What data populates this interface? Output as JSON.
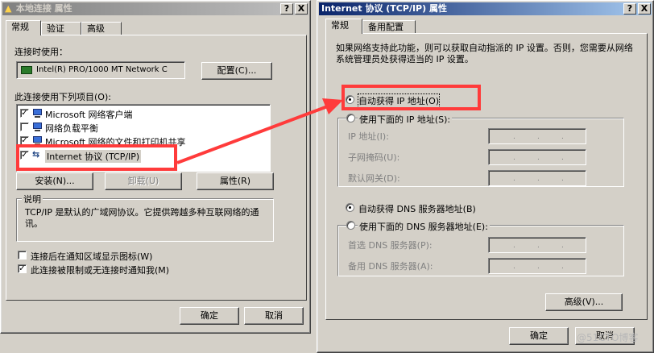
{
  "left_dialog": {
    "title": "本地连接 属性",
    "help_btn": "?",
    "close_btn": "X",
    "tabs": [
      "常规",
      "验证",
      "高级"
    ],
    "connect_using_label": "连接时使用：",
    "adapter_name": "Intel(R) PRO/1000 MT Network C",
    "configure_btn": "配置(C)...",
    "items_label": "此连接使用下列项目(O):",
    "items": [
      {
        "checked": true,
        "label": "Microsoft 网络客户端"
      },
      {
        "checked": false,
        "label": "网络负载平衡"
      },
      {
        "checked": true,
        "label": "Microsoft 网络的文件和打印机共享"
      },
      {
        "checked": true,
        "label": "Internet 协议 (TCP/IP)"
      }
    ],
    "install_btn": "安装(N)...",
    "uninstall_btn": "卸载(U)",
    "properties_btn": "属性(R)",
    "description_label": "说明",
    "description_text": "TCP/IP 是默认的广域网协议。它提供跨越多种互联网络的通讯。",
    "show_icon_label": "连接后在通知区域显示图标(W)",
    "notify_label": "此连接被限制或无连接时通知我(M)",
    "ok_btn": "确定",
    "cancel_btn": "取消"
  },
  "right_dialog": {
    "title": "Internet 协议 (TCP/IP) 属性",
    "help_btn": "?",
    "close_btn": "X",
    "tabs": [
      "常规",
      "备用配置"
    ],
    "intro_text": "如果网络支持此功能，则可以获取自动指派的 IP 设置。否则，您需要从网络系统管理员处获得适当的 IP 设置。",
    "auto_ip_label": "自动获得 IP 地址(O)",
    "manual_ip_label": "使用下面的 IP 地址(S):",
    "ip_address_label": "IP 地址(I):",
    "subnet_label": "子网掩码(U):",
    "gateway_label": "默认网关(D):",
    "auto_dns_label": "自动获得 DNS 服务器地址(B)",
    "manual_dns_label": "使用下面的 DNS 服务器地址(E):",
    "preferred_dns_label": "首选 DNS 服务器(P):",
    "alternate_dns_label": "备用 DNS 服务器(A):",
    "advanced_btn": "高级(V)...",
    "ok_btn": "确定",
    "cancel_btn": "取消",
    "auto_ip_selected": true,
    "auto_dns_selected": true
  },
  "watermark": "@51CTO博客",
  "colors": {
    "annotation_red": "#ff3b3b",
    "titlebar_active": "#0a246a",
    "titlebar_inactive": "#808080"
  }
}
